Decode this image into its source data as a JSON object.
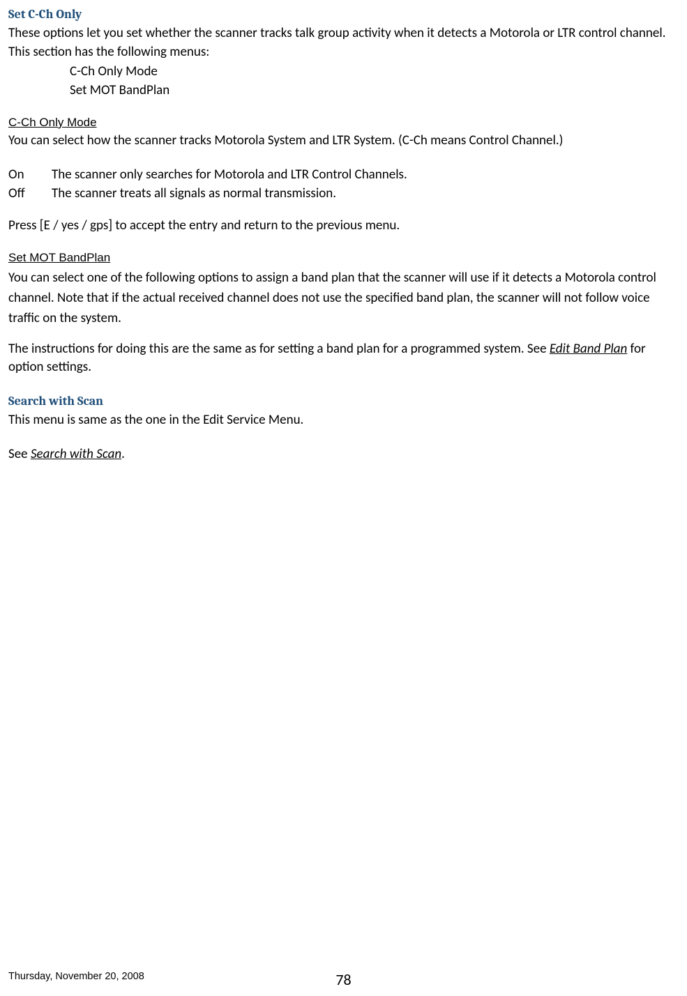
{
  "section1": {
    "title": "Set C-Ch Only",
    "intro": "These options let you set whether the scanner tracks talk group activity when it detects a Motorola or LTR control channel. This section has the following menus:",
    "menu_items": [
      "C-Ch Only Mode",
      "Set MOT BandPlan"
    ]
  },
  "sub1": {
    "title": "C-Ch Only Mode",
    "desc": "You can select how the scanner tracks Motorola System and LTR System. (C-Ch means Control Channel.)",
    "options": [
      {
        "label": "On",
        "text": "The scanner only searches for Motorola and LTR Control Channels."
      },
      {
        "label": "Off",
        "text": "The scanner treats all signals as normal transmission."
      }
    ],
    "accept": "Press [E / yes / gps] to accept the entry and return to the previous menu."
  },
  "sub2": {
    "title": "Set MOT BandPlan",
    "desc": "You can select one of the following options to assign a band plan that the scanner will use if it detects a Motorola control channel. Note that if the actual received channel does not use the specified band plan, the scanner will not follow voice traffic on the system.",
    "instr_pre": "The instructions for doing this are the same as for setting a band plan for a programmed system. See ",
    "instr_link": "Edit Band Plan",
    "instr_post": " for option settings."
  },
  "section2": {
    "title": "Search with Scan",
    "desc": "This menu is same as the one in the Edit Service Menu.",
    "see_pre": "See ",
    "see_link": "Search with Scan",
    "see_post": "."
  },
  "footer": {
    "date": "Thursday, November 20, 2008",
    "page": "78"
  }
}
